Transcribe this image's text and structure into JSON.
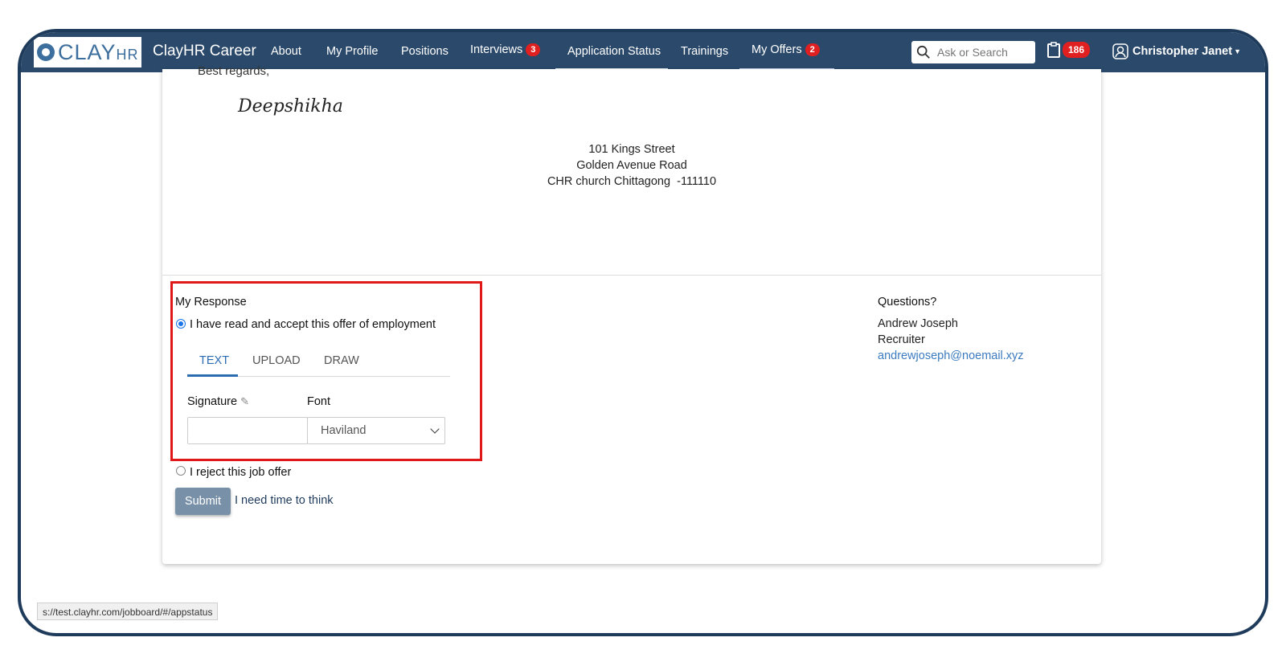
{
  "nav": {
    "logo": {
      "main": "CLAY",
      "sub": "HR"
    },
    "brand": "ClayHR Career",
    "items": [
      {
        "label": "About"
      },
      {
        "label": "My Profile"
      },
      {
        "label": "Positions"
      },
      {
        "label": "Interviews",
        "badge": "3"
      },
      {
        "label": "Application Status"
      },
      {
        "label": "Trainings"
      },
      {
        "label": "My Offers",
        "badge": "2"
      }
    ],
    "search_placeholder": "Ask or Search",
    "notifications_count": "186",
    "user_name": "Christopher Janet"
  },
  "letter": {
    "closing": "Best regards,",
    "signature": "Deepshikha",
    "address": [
      "101 Kings Street",
      "Golden Avenue Road",
      "CHR church Chittagong  -111110"
    ]
  },
  "response": {
    "title": "My Response",
    "accept_label": "I have read and accept this offer of employment",
    "tabs": [
      "TEXT",
      "UPLOAD",
      "DRAW"
    ],
    "active_tab": "TEXT",
    "signature_label": "Signature",
    "font_label": "Font",
    "signature_value": "",
    "font_selected": "Haviland",
    "reject_label": "I reject this job offer",
    "submit_label": "Submit",
    "think_label": "I need time to think"
  },
  "questions": {
    "title": "Questions?",
    "name": "Andrew Joseph",
    "role": "Recruiter",
    "email": "andrewjoseph@noemail.xyz"
  },
  "status_url": "s://test.clayhr.com/jobboard/#/appstatus",
  "colors": {
    "navbar": "#2b4a6b",
    "badge": "#e02020",
    "highlight_box": "#e01818",
    "link": "#3c7bbf",
    "submit": "#7890a8"
  }
}
